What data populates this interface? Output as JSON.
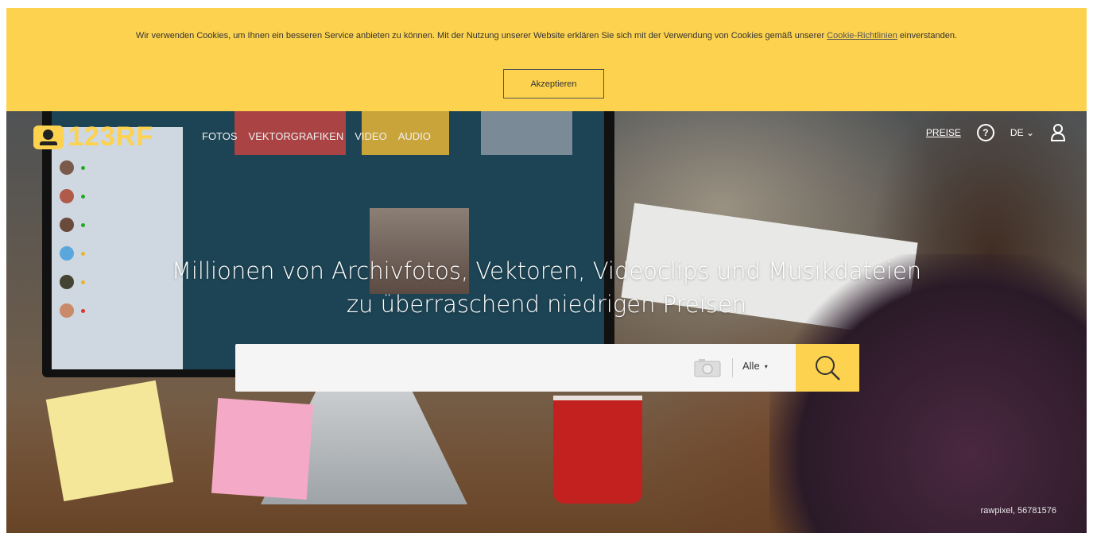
{
  "cookie": {
    "text_before": "Wir verwenden Cookies, um Ihnen ein besseren Service anbieten zu können. Mit der Nutzung unserer Website erklären Sie sich mit der Verwendung von Cookies gemäß unserer",
    "link_text": "Cookie-Richtlinien",
    "text_after": "einverstanden.",
    "accept_label": "Akzeptieren"
  },
  "header": {
    "logo_text": "123RF",
    "nav": [
      "FOTOS",
      "VEKTORGRAFIKEN",
      "VIDEO",
      "AUDIO"
    ],
    "pricing_label": "PREISE",
    "help_icon": "question-circle-icon",
    "language": "DE",
    "language_caret": "⌄",
    "user_icon": "user-icon"
  },
  "hero": {
    "headline_line1": "Millionen von Archivfotos, Vektoren, Videoclips und Musikdateien",
    "headline_line2": "zu überraschend niedrigen Preisen"
  },
  "search": {
    "placeholder": "",
    "value": "",
    "camera_icon": "camera-icon",
    "category": "Alle",
    "category_caret": "▾",
    "search_icon": "magnifier-icon"
  },
  "photo_credit": "rawpixel, 56781576",
  "colors": {
    "brand_yellow": "#fdd24f"
  }
}
